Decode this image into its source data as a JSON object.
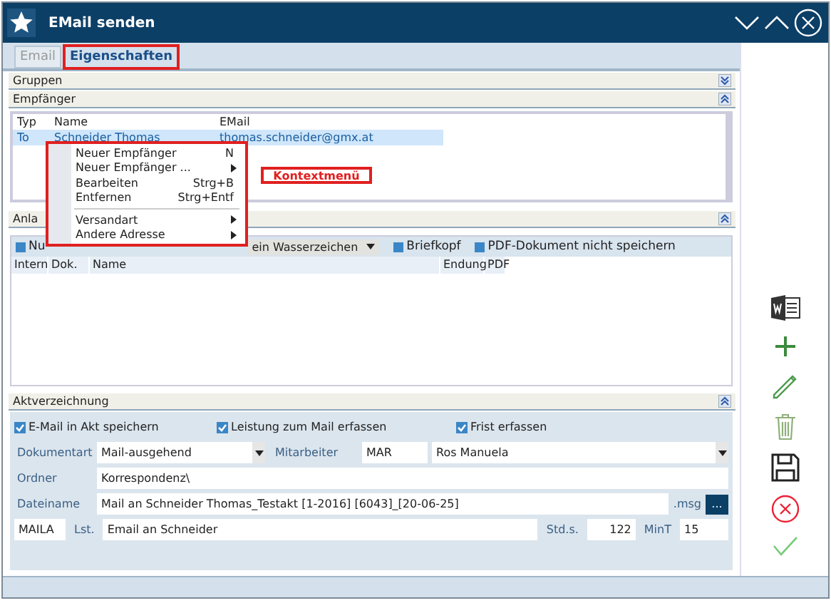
{
  "window": {
    "title": "EMail senden"
  },
  "tabs": [
    {
      "label": "Email",
      "selected": false,
      "highlighted": false
    },
    {
      "label": "Eigenschaften",
      "selected": true,
      "highlighted": true
    }
  ],
  "sections": {
    "gruppen": {
      "title": "Gruppen",
      "expanded": false
    },
    "empfaenger": {
      "title": "Empfänger",
      "expanded": true
    },
    "anlagen": {
      "title": "Anla",
      "expanded": true
    },
    "akt": {
      "title": "Aktverzeichnung",
      "expanded": true
    }
  },
  "recipients": {
    "columns": [
      "Typ",
      "Name",
      "EMail"
    ],
    "rows": [
      {
        "type": "To",
        "name": "Schneider Thomas",
        "email": "thomas.schneider@gmx.at",
        "selected": true
      }
    ]
  },
  "context_menu": {
    "highlighted": true,
    "items": [
      {
        "kind": "item",
        "label": "Neuer Empfänger",
        "shortcut": "N",
        "submenu": false
      },
      {
        "kind": "item",
        "label": "Neuer Empfänger ...",
        "submenu": true
      },
      {
        "kind": "item",
        "label": "Bearbeiten",
        "shortcut": "Strg+B",
        "submenu": false
      },
      {
        "kind": "item",
        "label": "Entfernen",
        "shortcut": "Strg+Entf",
        "submenu": false
      },
      {
        "kind": "separator"
      },
      {
        "kind": "item",
        "label": "Versandart",
        "submenu": true
      },
      {
        "kind": "item",
        "label": "Andere Adresse",
        "submenu": true
      }
    ]
  },
  "annotation": {
    "text": "Kontextmenü"
  },
  "attachments": {
    "toolbar": [
      {
        "kind": "checkbox",
        "label": "Nu",
        "checked": false
      },
      {
        "kind": "dropdown",
        "value": "ein Wasserzeichen"
      },
      {
        "kind": "checkbox",
        "label": "Briefkopf",
        "checked": false
      },
      {
        "kind": "checkbox",
        "label": "PDF-Dokument nicht speichern",
        "checked": false
      }
    ],
    "columns": [
      "Intern",
      "Dok.",
      "Name",
      "Endung",
      "PDF"
    ]
  },
  "akt": {
    "checkboxes": [
      {
        "label": "E-Mail in Akt speichern",
        "checked": true
      },
      {
        "label": "Leistung zum Mail erfassen",
        "checked": true
      },
      {
        "label": "Frist erfassen",
        "checked": true
      }
    ],
    "dokumentart": {
      "label": "Dokumentart",
      "value": "Mail-ausgehend"
    },
    "mitarbeiter": {
      "label": "Mitarbeiter",
      "code": "MAR",
      "name": "Ros Manuela"
    },
    "ordner": {
      "label": "Ordner",
      "value": "Korrespondenz\\"
    },
    "dateiname": {
      "label": "Dateiname",
      "value": "Mail an Schneider Thomas_Testakt [1-2016]  [6043]_[20-06-25]",
      "ext": ".msg",
      "button": "..."
    },
    "code": "MAILA",
    "lst": {
      "label": "Lst.",
      "value": "Email an Schneider"
    },
    "std": {
      "label": "Std.s.",
      "value": "122"
    },
    "mint": {
      "label": "MinT",
      "value": "15"
    }
  }
}
